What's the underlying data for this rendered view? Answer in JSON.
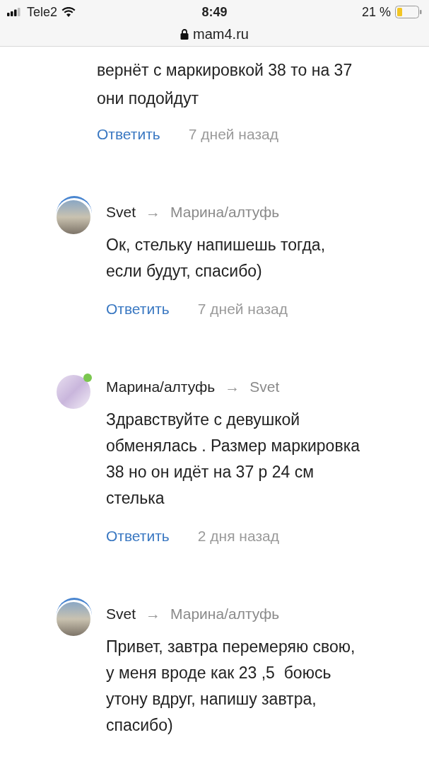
{
  "status_bar": {
    "carrier": "Tele2",
    "time": "8:49",
    "battery": "21 %",
    "url": "mam4.ru"
  },
  "continued_comment": {
    "body": [
      "вернёт с маркировкой 38 то на 37",
      "они подойдут"
    ],
    "reply": "Ответить",
    "time": "7 дней назад"
  },
  "comments": [
    {
      "author": "Svet",
      "arrow": "→",
      "recipient": "Марина/алтуфь",
      "online": false,
      "ring": true,
      "body": [
        "Ок, стельку напишешь тогда,",
        "если будут, спасибо)"
      ],
      "reply": "Ответить",
      "time": "7 дней назад"
    },
    {
      "author": "Марина/алтуфь",
      "arrow": "→",
      "recipient": "Svet",
      "online": true,
      "ring": false,
      "body": [
        "Здравствуйте с девушкой",
        "обменялась . Размер маркировка",
        "38 но он идёт на 37 р 24 см",
        "стелька"
      ],
      "reply": "Ответить",
      "time": "2 дня назад"
    },
    {
      "author": "Svet",
      "arrow": "→",
      "recipient": "Марина/алтуфь",
      "online": false,
      "ring": true,
      "body": [
        "Привет, завтра перемеряю свою,",
        "у меня вроде как 23 ,5  боюсь",
        "утону вдруг, напишу завтра,",
        "спасибо)"
      ]
    }
  ]
}
